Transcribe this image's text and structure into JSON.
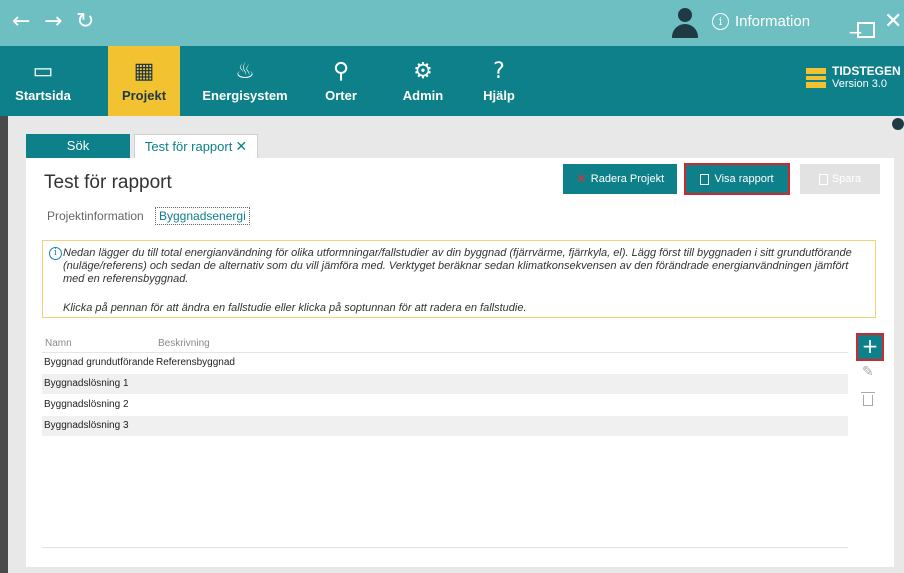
{
  "titlebar": {
    "back_icon": "←",
    "forward_icon": "→",
    "refresh_icon": "↻",
    "info_label": "Information",
    "info_glyph": "i",
    "minimize_icon": "_",
    "close_icon": "✕"
  },
  "menu": {
    "items": [
      {
        "label": "Startsida",
        "icon": "▭"
      },
      {
        "label": "Projekt",
        "icon": "▦"
      },
      {
        "label": "Energisystem",
        "icon": "♨"
      },
      {
        "label": "Orter",
        "icon": "⚲"
      },
      {
        "label": "Admin",
        "icon": "⚙"
      },
      {
        "label": "Hjälp",
        "icon": "?"
      }
    ]
  },
  "brand": {
    "name": "TIDSTEGEN",
    "version": "Version 3.0"
  },
  "tabs": [
    {
      "label": "Sök"
    },
    {
      "label": "Test för rapport",
      "close": "✕"
    }
  ],
  "project": {
    "title": "Test för rapport",
    "buttons": {
      "delete": "Radera Projekt",
      "delete_mark": "✕",
      "report": "Visa rapport",
      "save": "Spara"
    }
  },
  "subtabs": [
    {
      "label": "Projektinformation"
    },
    {
      "label": "Byggnadsenergi"
    }
  ],
  "info": {
    "glyph": "i",
    "paragraph1": "Nedan lägger du till total energianvändning för olika utformningar/fallstudier av din byggnad (fjärrvärme, fjärrkyla, el). Lägg först till byggnaden i sitt grundutförande (nuläge/referens) och sedan de alternativ som du vill jämföra med. Verktyget beräknar sedan klimatkonsekvensen av den förändrade energianvändningen jämfört med en referensbyggnad.",
    "paragraph2": "Klicka på pennan för att ändra en fallstudie eller klicka på soptunnan för att radera en fallstudie."
  },
  "table": {
    "columns": [
      "Namn",
      "Beskrivning"
    ],
    "rows": [
      {
        "name": "Byggnad grundutförande",
        "description": "Referensbyggnad"
      },
      {
        "name": "Byggnadslösning 1",
        "description": ""
      },
      {
        "name": "Byggnadslösning 2",
        "description": ""
      },
      {
        "name": "Byggnadslösning 3",
        "description": ""
      }
    ]
  },
  "actions": {
    "add": "+",
    "edit": "✎"
  },
  "colors": {
    "teal": "#0e8089",
    "teal_light": "#6ebfc2",
    "accent_yellow": "#f2c230",
    "highlight_red": "#d3272f"
  }
}
